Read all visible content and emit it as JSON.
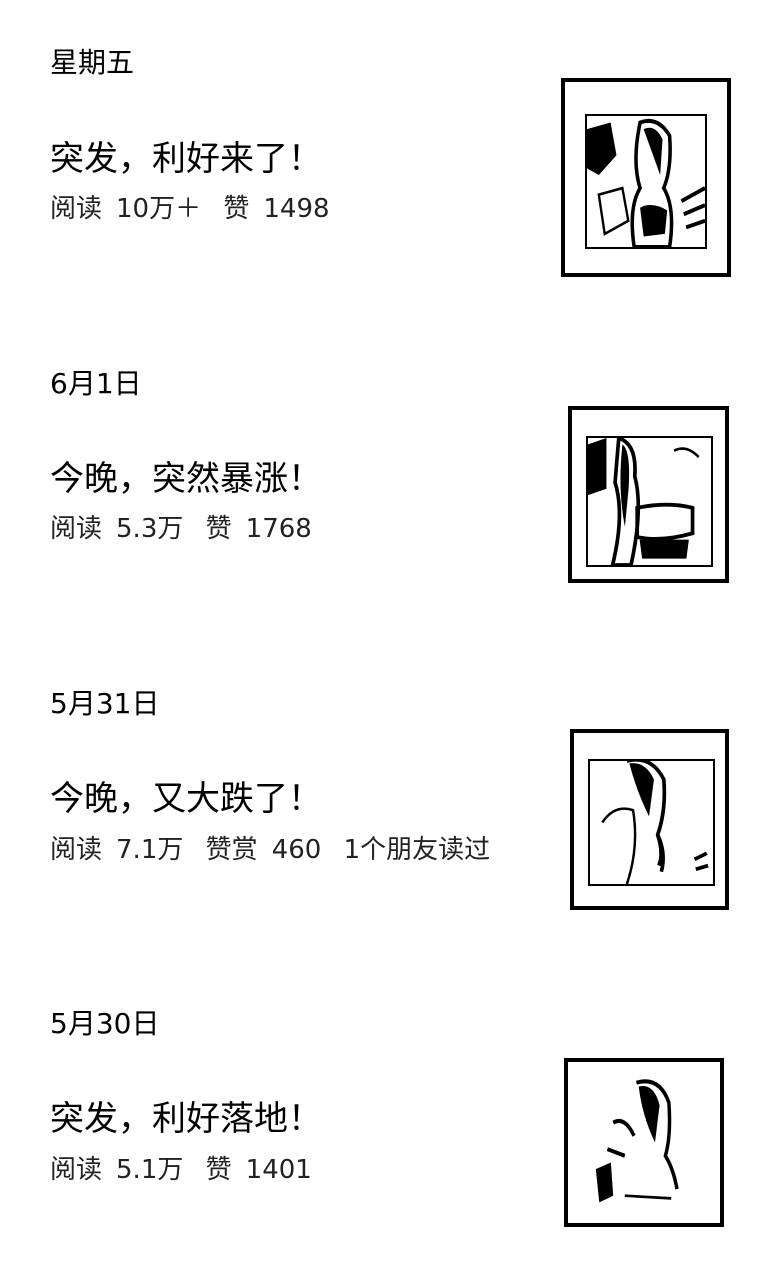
{
  "articles": [
    {
      "date": "星期五",
      "title": "突发，利好来了！",
      "read_label": "阅读",
      "read_value": "10万＋",
      "like_label": "赞",
      "like_value": "1498",
      "friends": ""
    },
    {
      "date": "6月1日",
      "title": "今晚，突然暴涨！",
      "read_label": "阅读",
      "read_value": "5.3万",
      "like_label": "赞",
      "like_value": "1768",
      "friends": ""
    },
    {
      "date": "5月31日",
      "title": "今晚，又大跌了！",
      "read_label": "阅读",
      "read_value": "7.1万",
      "like_label": "赞赏",
      "like_value": "460",
      "friends": "1个朋友读过"
    },
    {
      "date": "5月30日",
      "title": "突发，利好落地！",
      "read_label": "阅读",
      "read_value": "5.1万",
      "like_label": "赞",
      "like_value": "1401",
      "friends": ""
    }
  ],
  "thumbnails": [
    {
      "icon": "portrait-photo-icon"
    },
    {
      "icon": "portrait-photo-icon"
    },
    {
      "icon": "portrait-photo-icon"
    },
    {
      "icon": "portrait-photo-icon"
    }
  ]
}
